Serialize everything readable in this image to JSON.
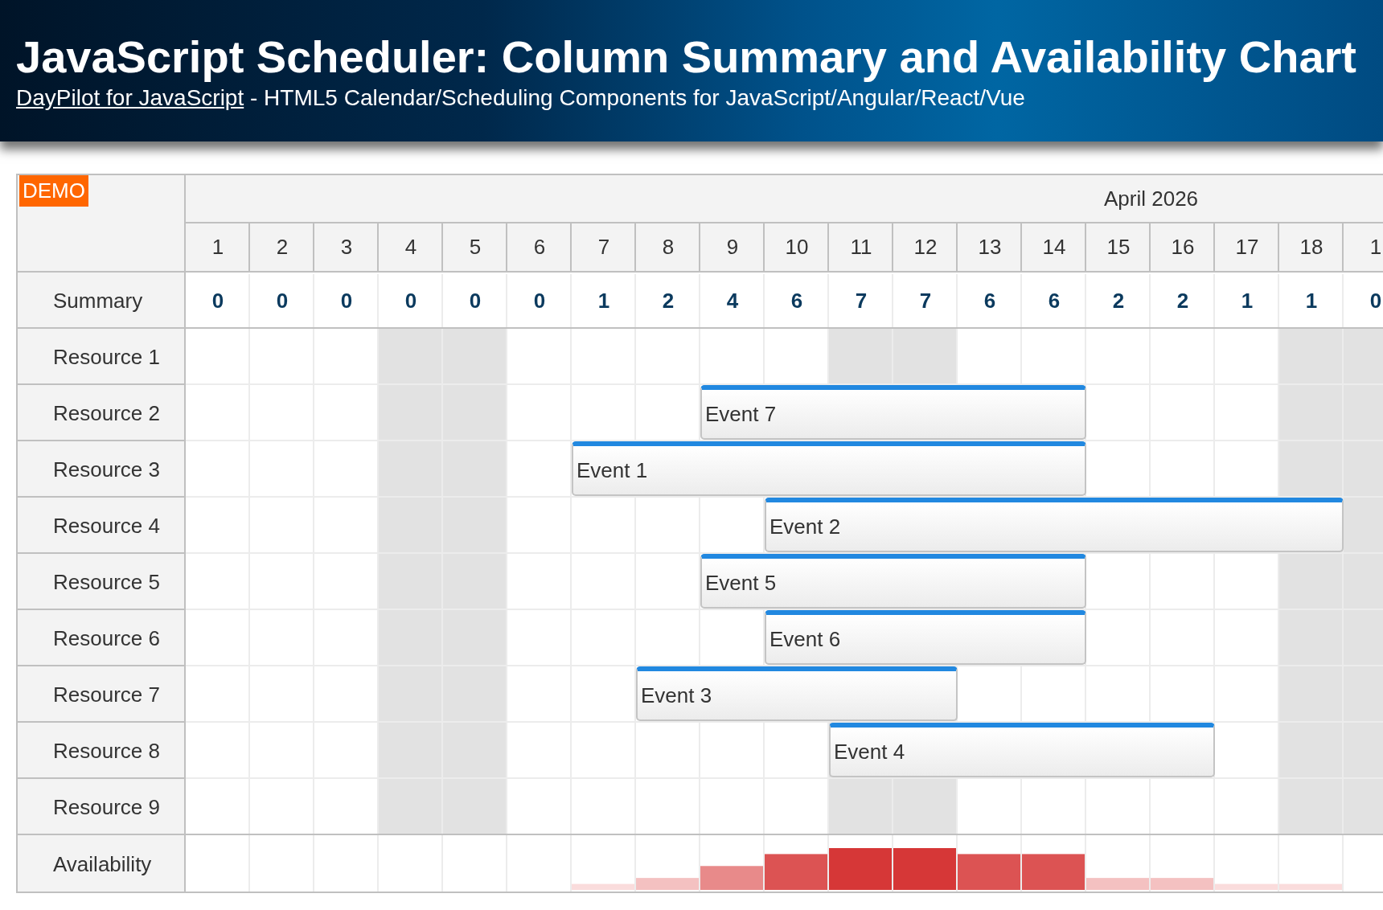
{
  "header": {
    "title": "JavaScript Scheduler: Column Summary and Availability Chart",
    "subtitle": {
      "link": "DayPilot for JavaScript",
      "text": "- HTML5 Calendar/Scheduling Components for JavaScript/Angular/React/Vue"
    }
  },
  "scheduler": {
    "badge": "DEMO",
    "month": "April 2026",
    "days": [
      {
        "label": "1",
        "weekend": false
      },
      {
        "label": "2",
        "weekend": false
      },
      {
        "label": "3",
        "weekend": false
      },
      {
        "label": "4",
        "weekend": true
      },
      {
        "label": "5",
        "weekend": true
      },
      {
        "label": "6",
        "weekend": false
      },
      {
        "label": "7",
        "weekend": false
      },
      {
        "label": "8",
        "weekend": false
      },
      {
        "label": "9",
        "weekend": false
      },
      {
        "label": "10",
        "weekend": false
      },
      {
        "label": "11",
        "weekend": true
      },
      {
        "label": "12",
        "weekend": true
      },
      {
        "label": "13",
        "weekend": false
      },
      {
        "label": "14",
        "weekend": false
      },
      {
        "label": "15",
        "weekend": false
      },
      {
        "label": "16",
        "weekend": false
      },
      {
        "label": "17",
        "weekend": false
      },
      {
        "label": "18",
        "weekend": true
      },
      {
        "label": "1",
        "weekend": true
      }
    ],
    "summary": {
      "label": "Summary",
      "values": [
        "0",
        "0",
        "0",
        "0",
        "0",
        "0",
        "1",
        "2",
        "4",
        "6",
        "7",
        "7",
        "6",
        "6",
        "2",
        "2",
        "1",
        "1",
        "0"
      ]
    },
    "resources": [
      {
        "name": "Resource 1"
      },
      {
        "name": "Resource 2",
        "events": [
          {
            "text": "Event 7"
          }
        ]
      },
      {
        "name": "Resource 3",
        "events": [
          {
            "text": "Event 1"
          }
        ]
      },
      {
        "name": "Resource 4",
        "events": [
          {
            "text": "Event 2"
          }
        ]
      },
      {
        "name": "Resource 5",
        "events": [
          {
            "text": "Event 5"
          }
        ]
      },
      {
        "name": "Resource 6",
        "events": [
          {
            "text": "Event 6"
          }
        ]
      },
      {
        "name": "Resource 7",
        "events": [
          {
            "text": "Event 3"
          }
        ]
      },
      {
        "name": "Resource 8",
        "events": [
          {
            "text": "Event 4"
          }
        ]
      },
      {
        "name": "Resource 9"
      }
    ],
    "availability": {
      "label": "Availability"
    }
  }
}
